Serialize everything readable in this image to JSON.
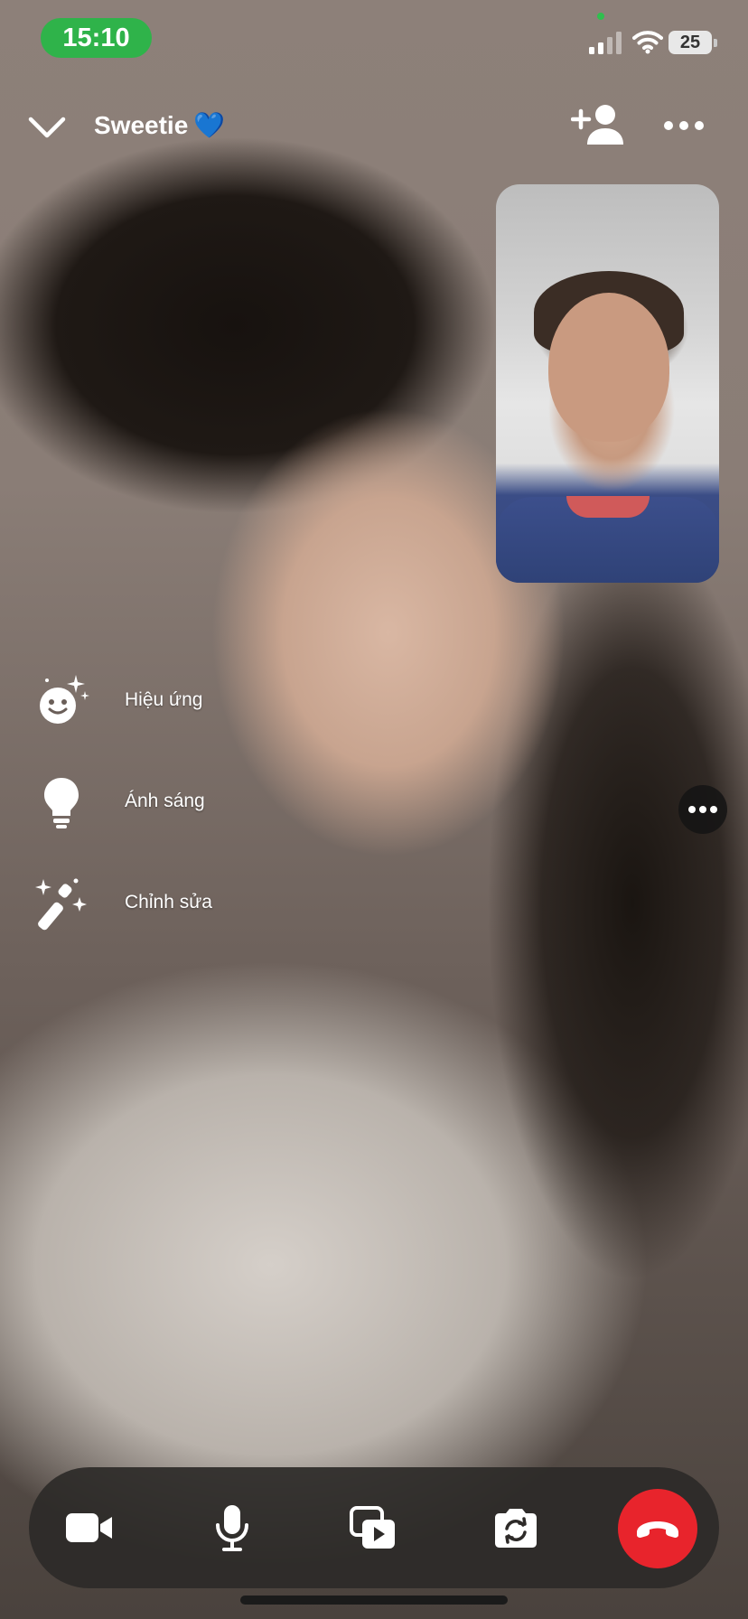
{
  "status_bar": {
    "time": "15:10",
    "battery": "25",
    "icons": [
      "camera-in-use-dot",
      "signal-icon",
      "wifi-icon",
      "battery-icon"
    ],
    "time_pill_color": "#2fb34a"
  },
  "header": {
    "contact_name": "Sweetie",
    "name_emoji": "💙",
    "icons": [
      "chevron-down-icon",
      "add-person-icon",
      "more-icon"
    ]
  },
  "effects": [
    {
      "label": "Hiệu ứng",
      "icon": "smiley-sparkle-icon"
    },
    {
      "label": "Ánh sáng",
      "icon": "lightbulb-icon"
    },
    {
      "label": "Chỉnh sửa",
      "icon": "magic-wand-icon"
    }
  ],
  "controls": [
    {
      "icon": "video-camera-icon"
    },
    {
      "icon": "microphone-icon"
    },
    {
      "icon": "share-media-icon"
    },
    {
      "icon": "flip-camera-icon"
    },
    {
      "icon": "end-call-icon",
      "color": "#e8242c"
    }
  ]
}
